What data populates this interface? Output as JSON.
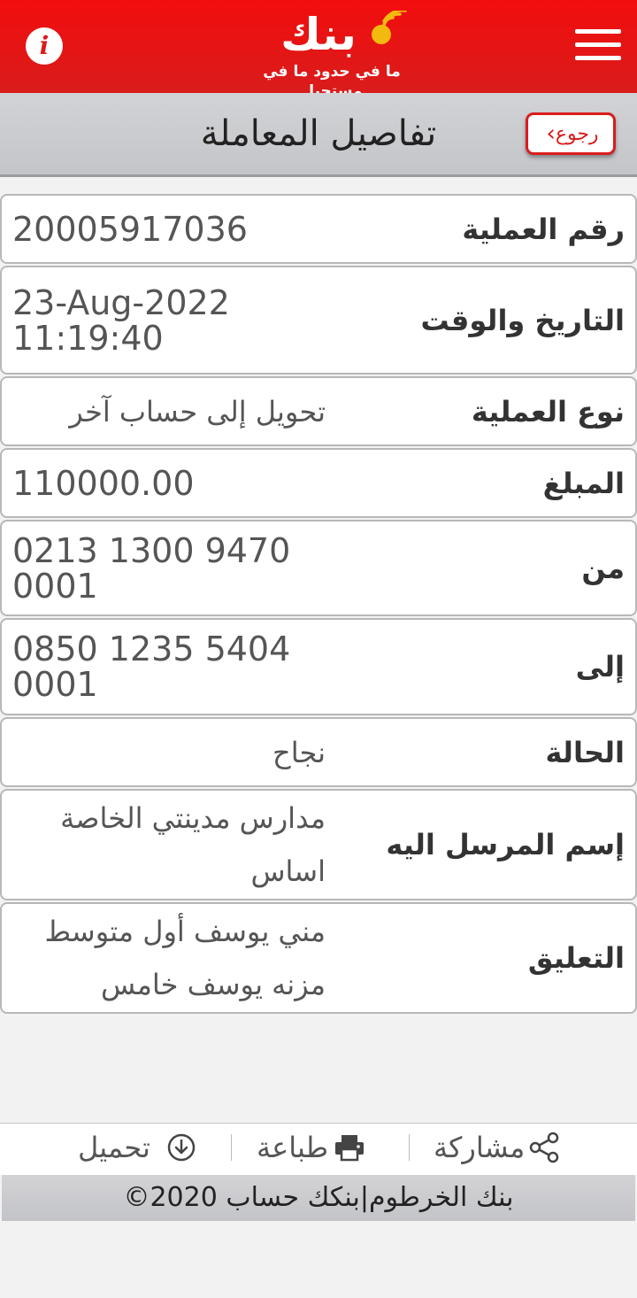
{
  "header": {
    "logo_word": "بنك",
    "logo_tagline": "ما في حدود ما في مستحيل",
    "info_icon": "info-icon",
    "menu_icon": "hamburger-menu-icon",
    "colors": {
      "brand_red": "#d91c1c",
      "logo_accent": "#f2b90f"
    }
  },
  "titlebar": {
    "title": "تفاصيل المعاملة",
    "back_label": "رجوع"
  },
  "details": [
    {
      "label": "رقم العملية",
      "value": [
        "20005917036"
      ]
    },
    {
      "label": "التاريخ والوقت",
      "value": [
        "23-Aug-2022",
        "11:19:40"
      ]
    },
    {
      "label": "نوع العملية",
      "value": [
        "تحويل إلى حساب آخر"
      ]
    },
    {
      "label": "المبلغ",
      "value": [
        "110000.00"
      ]
    },
    {
      "label": "من",
      "value": [
        "0213 1300 9470",
        "0001"
      ]
    },
    {
      "label": "إلى",
      "value": [
        "0850 1235 5404",
        "0001"
      ]
    },
    {
      "label": "الحالة",
      "value": [
        "نجاح"
      ]
    },
    {
      "label": "إسم المرسل اليه",
      "value": [
        "مدارس مدينتي الخاصة",
        "اساس"
      ]
    },
    {
      "label": "التعليق",
      "value": [
        "مني يوسف أول متوسط",
        "مزنه يوسف خامس"
      ]
    }
  ],
  "actions": {
    "share": "مشاركة",
    "print": "طباعة",
    "download": "تحميل"
  },
  "footer": {
    "text": "©2020 بنك الخرطوم|بنكك حساب"
  }
}
